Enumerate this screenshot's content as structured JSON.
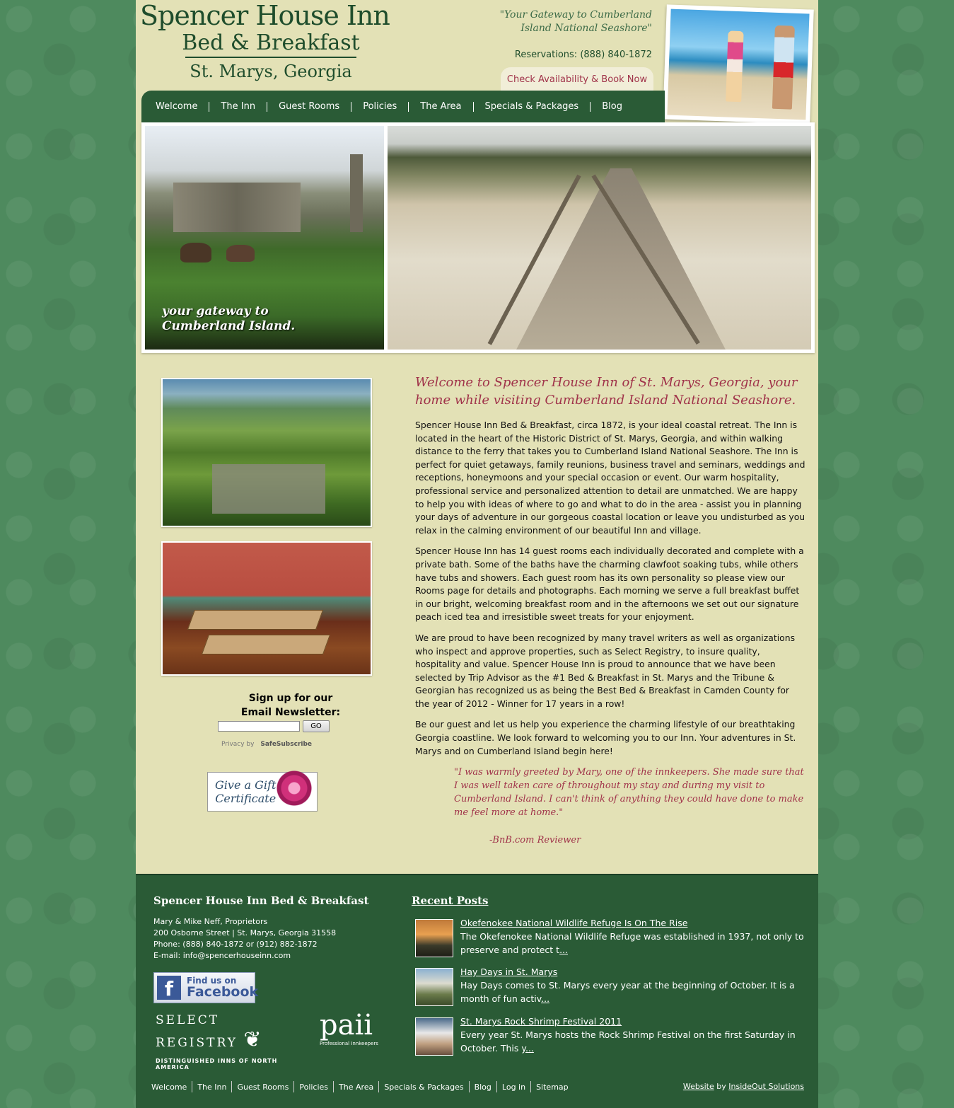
{
  "header": {
    "logo_line1": "Spencer House Inn",
    "logo_line2": "Bed & Breakfast",
    "logo_line3": "St. Marys, Georgia",
    "tagline_line1": "\"Your Gateway to Cumberland",
    "tagline_line2": "Island National Seashore\"",
    "reservations": "Reservations: (888) 840-1872",
    "book_button": "Check Availability & Book Now"
  },
  "nav": {
    "items": [
      "Welcome",
      "The Inn",
      "Guest Rooms",
      "Policies",
      "The Area",
      "Specials & Packages",
      "Blog"
    ]
  },
  "hero": {
    "caption_line1": "your gateway to",
    "caption_line2": "Cumberland Island."
  },
  "sidebar": {
    "signup_title": "Sign up for our Email Newsletter:",
    "go_button": "GO",
    "privacy_label": "Privacy by",
    "privacy_brand": "SafeSubscribe",
    "gift_line1": "Give a Gift",
    "gift_line2": "Certificate"
  },
  "main": {
    "title": "Welcome to Spencer House Inn of St. Marys, Georgia, your home while visiting Cumberland Island National Seashore.",
    "paragraphs": [
      "Spencer House Inn Bed & Breakfast, circa 1872, is your ideal coastal retreat. The Inn is located in the heart of the Historic District of St. Marys, Georgia, and within walking distance to the ferry that takes you to Cumberland Island National Seashore. The Inn is perfect for quiet getaways, family reunions, business travel and seminars, weddings and receptions, honeymoons and your special occasion or event. Our warm hospitality, professional service and personalized attention to detail are unmatched. We are happy to help you with ideas of where to go and what to do in the area - assist you in planning your days of adventure in our gorgeous coastal location or leave you undisturbed as you relax in the calming environment of our beautiful Inn and village.",
      "Spencer House Inn has 14 guest rooms each individually decorated and complete with a private bath. Some of the baths have the charming clawfoot soaking tubs, while others have tubs and showers. Each guest room has its own personality so please view our Rooms page for details and photographs. Each morning we serve a full breakfast buffet in our bright, welcoming breakfast room and in the afternoons we set out our signature peach iced tea and irresistible sweet treats for your enjoyment.",
      "We are proud to have been recognized by many travel writers as well as organizations who inspect and approve properties, such as Select Registry, to insure quality, hospitality and value. Spencer House Inn is proud to announce that we have been selected by Trip Advisor as the #1 Bed & Breakfast in St. Marys and the Tribune & Georgian has recognized us as being the Best Bed & Breakfast in Camden County for the year of 2012 - Winner for 17 years in a row!",
      "Be our guest and let us help you experience the charming lifestyle of our breathtaking Georgia coastline. We look forward to welcoming you to our Inn. Your adventures in St. Marys and on Cumberland Island begin here!"
    ],
    "quote": "\"I was warmly greeted by Mary, one of the innkeepers. She made sure that I was well taken care of throughout my stay and during my visit to Cumberland Island. I can't think of anything they could have done to make me feel more at home.\"",
    "quote_author": "-BnB.com Reviewer"
  },
  "footer": {
    "title": "Spencer House Inn Bed & Breakfast",
    "proprietors": "Mary & Mike Neff, Proprietors",
    "address": "200 Osborne Street | St. Marys, Georgia 31558",
    "phone": "Phone: (888) 840-1872 or (912) 882-1872",
    "email": "E-mail: info@spencerhouseinn.com",
    "facebook_small": "Find us on",
    "facebook_big": "Facebook",
    "select_registry": "SELECT REGISTRY",
    "select_registry_sub": "DISTINGUISHED INNS OF NORTH AMERICA",
    "paii": "paii",
    "paii_sub": "Professional Innkeepers",
    "recent_posts_title": "Recent Posts",
    "posts": [
      {
        "title": "Okefenokee National Wildlife Refuge Is On The Rise",
        "excerpt": "The Okefenokee National Wildlife Refuge was established in 1937, not only to preserve and protect t",
        "more": "..."
      },
      {
        "title": "Hay Days in St. Marys",
        "excerpt": " Hay Days comes to St. Marys every year at the beginning of October. It is a month of fun activ",
        "more": "..."
      },
      {
        "title": "St. Marys Rock Shrimp Festival 2011",
        "excerpt": "Every year St. Marys hosts the Rock Shrimp Festival on the first Saturday in October. This y",
        "more": "..."
      }
    ],
    "nav": [
      "Welcome",
      "The Inn",
      "Guest Rooms",
      "Policies",
      "The Area",
      "Specials & Packages",
      "Blog",
      "Log in",
      "Sitemap"
    ],
    "credit_website": "Website",
    "credit_by": "by",
    "credit_company": "InsideOut Solutions"
  }
}
